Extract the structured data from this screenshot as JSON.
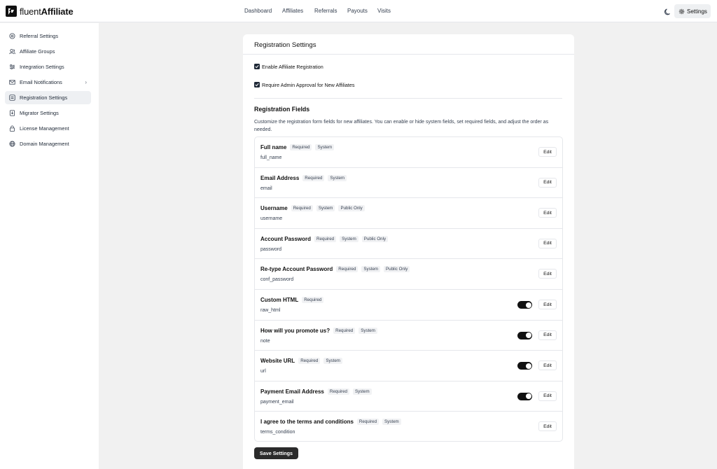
{
  "brand": {
    "light": "fluent",
    "bold": "Affiliate"
  },
  "nav": [
    "Dashboard",
    "Affiliates",
    "Referrals",
    "Payouts",
    "Visits"
  ],
  "header": {
    "settings_label": "Settings"
  },
  "sidebar": {
    "items": [
      {
        "label": "Referral Settings",
        "icon": "target-icon"
      },
      {
        "label": "Affiliate Groups",
        "icon": "users-icon"
      },
      {
        "label": "Integration Settings",
        "icon": "sliders-icon"
      },
      {
        "label": "Email Notifications",
        "icon": "mail-icon"
      },
      {
        "label": "Registration Settings",
        "icon": "form-icon",
        "active": true
      },
      {
        "label": "Migrator Settings",
        "icon": "import-icon"
      },
      {
        "label": "License Management",
        "icon": "lock-icon"
      },
      {
        "label": "Domain Management",
        "icon": "globe-icon"
      }
    ]
  },
  "panel": {
    "title": "Registration Settings",
    "options": [
      {
        "label": "Enable Affiliate Registration",
        "checked": true
      },
      {
        "label": "Require Admin Approval for New Affiliates",
        "checked": true
      }
    ],
    "fields_title": "Registration Fields",
    "fields_desc": "Customize the registration form fields for new affiliates. You can enable or hide system fields, set required fields, and adjust the order as needed.",
    "edit_label": "Edit",
    "save_label": "Save Settings"
  },
  "fields": [
    {
      "name": "Full name",
      "key": "full_name",
      "badges": [
        "Required",
        "System"
      ],
      "toggle": false
    },
    {
      "name": "Email Address",
      "key": "email",
      "badges": [
        "Required",
        "System"
      ],
      "toggle": false
    },
    {
      "name": "Username",
      "key": "username",
      "badges": [
        "Required",
        "System",
        "Public Only"
      ],
      "toggle": false
    },
    {
      "name": "Account Password",
      "key": "password",
      "badges": [
        "Required",
        "System",
        "Public Only"
      ],
      "toggle": false
    },
    {
      "name": "Re-type Account Password",
      "key": "conf_password",
      "badges": [
        "Required",
        "System",
        "Public Only"
      ],
      "toggle": false
    },
    {
      "name": "Custom HTML",
      "key": "raw_html",
      "badges": [
        "Required"
      ],
      "toggle": true
    },
    {
      "name": "How will you promote us?",
      "key": "note",
      "badges": [
        "Required",
        "System"
      ],
      "toggle": true
    },
    {
      "name": "Website URL",
      "key": "url",
      "badges": [
        "Required",
        "System"
      ],
      "toggle": true
    },
    {
      "name": "Payment Email Address",
      "key": "payment_email",
      "badges": [
        "Required",
        "System"
      ],
      "toggle": true
    },
    {
      "name": "I agree to the terms and conditions",
      "key": "terms_condition",
      "badges": [
        "Required",
        "System"
      ],
      "toggle": false
    }
  ]
}
